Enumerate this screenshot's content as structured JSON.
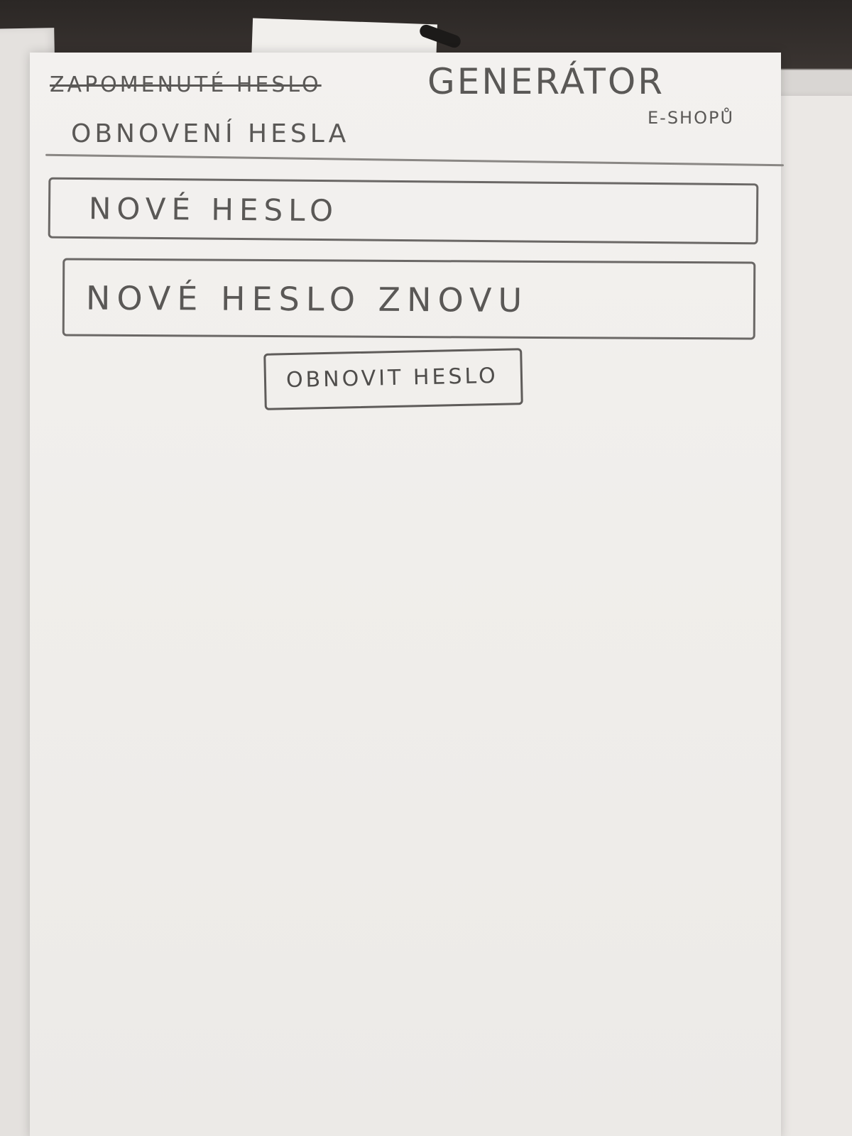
{
  "header": {
    "struck_title": "ZAPOMENUTÉ HESLO",
    "brand": "GENERÁTOR",
    "brand_sub": "E-SHOPŮ"
  },
  "page_title": "OBNOVENÍ HESLA",
  "form": {
    "new_password_placeholder": "NOVÉ HESLO",
    "confirm_password_placeholder": "NOVÉ HESLO ZNOVU",
    "submit_label": "OBNOVIT HESLO"
  }
}
